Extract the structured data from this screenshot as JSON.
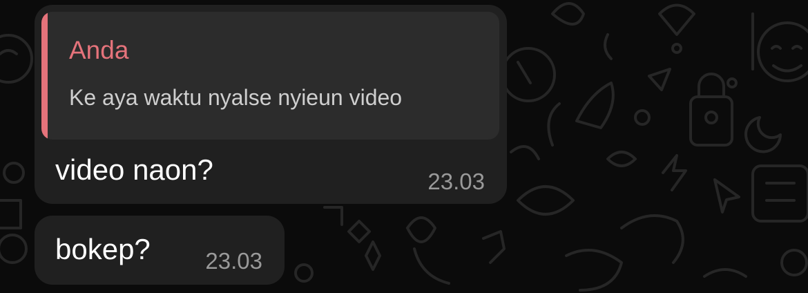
{
  "chat": {
    "background_color": "#0b0b0b",
    "messages": [
      {
        "reply": {
          "author": "Anda",
          "text": "Ke aya waktu nyalse nyieun video",
          "accent_color": "#e5737b"
        },
        "text": "video naon?",
        "time": "23.03"
      },
      {
        "text": "bokep?",
        "time": "23.03"
      }
    ]
  }
}
